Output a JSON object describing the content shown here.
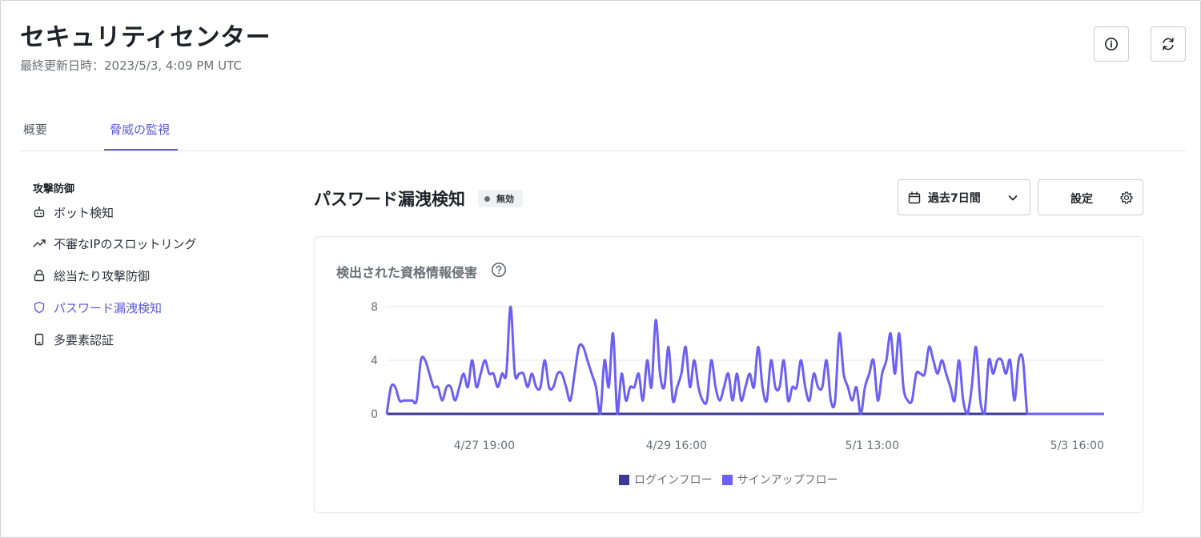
{
  "header": {
    "title": "セキュリティセンター",
    "last_updated": "最終更新日時：2023/5/3, 4:09 PM UTC",
    "info_icon": "info-icon",
    "refresh_icon": "refresh-icon"
  },
  "tabs": [
    {
      "label": "概要",
      "active": false
    },
    {
      "label": "脅威の監視",
      "active": true
    }
  ],
  "sidebar": {
    "heading": "攻撃防御",
    "items": [
      {
        "label": "ボット検知",
        "icon": "robot-icon",
        "active": false
      },
      {
        "label": "不審なIPのスロットリング",
        "icon": "trending-up-icon",
        "active": false
      },
      {
        "label": "総当たり攻撃防御",
        "icon": "lock-icon",
        "active": false
      },
      {
        "label": "パスワード漏洩検知",
        "icon": "shield-icon",
        "active": true
      },
      {
        "label": "多要素認証",
        "icon": "phone-icon",
        "active": false
      }
    ]
  },
  "main": {
    "title": "パスワード漏洩検知",
    "status": "無効",
    "range_select": {
      "value": "過去7日間",
      "icon": "calendar-icon"
    },
    "settings_label": "設定",
    "card_title": "検出された資格情報侵害"
  },
  "colors": {
    "accent": "#5a5bdb",
    "series_login": "#3d3a96",
    "series_signup": "#6b5ff8"
  },
  "chart_data": {
    "type": "line",
    "title": "",
    "xlabel": "",
    "ylabel": "",
    "ylim": [
      0,
      8
    ],
    "y_ticks": [
      0,
      4,
      8
    ],
    "x_ticks": [
      "4/27 19:00",
      "4/29 16:00",
      "5/1 13:00",
      "5/3 16:00"
    ],
    "x_tick_index": [
      30,
      75,
      120,
      168
    ],
    "grid": true,
    "legend_position": "bottom",
    "series": [
      {
        "name": "ログインフロー",
        "color": "#3d3a96",
        "values": [
          0,
          0,
          0,
          0,
          0,
          0,
          0,
          0,
          0,
          0,
          0,
          0,
          0,
          0,
          0,
          0,
          0,
          0,
          0,
          0,
          0,
          0,
          0,
          0,
          0,
          0,
          0,
          0,
          0,
          0,
          0,
          0,
          0,
          0,
          0,
          0,
          0,
          0,
          0,
          0,
          0,
          0,
          0,
          0,
          0,
          0,
          0,
          0,
          0,
          0,
          0,
          0,
          0,
          0,
          0,
          0,
          0,
          0,
          0,
          0,
          0,
          0,
          0,
          0,
          0,
          0,
          0,
          0,
          0,
          0,
          0,
          0,
          0,
          0,
          0,
          0,
          0,
          0,
          0,
          0,
          0,
          0,
          0,
          0,
          0,
          0,
          0,
          0,
          0,
          0,
          0,
          0,
          0,
          0,
          0,
          0,
          0,
          0,
          0,
          0,
          0,
          0,
          0,
          0,
          0,
          0,
          0,
          0,
          0,
          0,
          0,
          0,
          0,
          0,
          0,
          0,
          0,
          0,
          0,
          0,
          0,
          0,
          0,
          0,
          0,
          0,
          0,
          0
        ]
      },
      {
        "name": "サインアップフロー",
        "color": "#6b5ff8",
        "values": [
          0,
          2,
          2,
          1,
          1,
          1,
          1,
          1,
          4,
          4,
          3,
          2,
          2,
          1,
          2,
          2,
          1,
          2,
          3,
          2,
          4,
          2,
          3,
          4,
          3,
          3,
          2,
          3,
          3,
          8,
          3,
          3,
          3,
          2,
          3,
          2,
          2,
          4,
          2,
          2,
          3,
          3,
          2,
          1,
          3,
          5,
          5,
          4,
          3,
          2,
          0,
          4,
          2,
          6,
          0,
          3,
          1,
          2,
          2,
          3,
          1,
          4,
          2,
          7,
          3,
          2,
          5,
          1,
          2,
          3,
          5,
          2,
          4,
          2,
          1,
          1,
          4,
          2,
          1,
          2,
          3,
          1,
          3,
          1,
          2,
          3,
          2,
          5,
          2,
          1,
          4,
          2,
          2,
          4,
          1,
          2,
          2,
          4,
          2,
          1,
          3,
          2,
          2,
          4,
          1,
          1,
          6,
          3,
          2,
          1,
          2,
          0,
          2,
          3,
          4,
          1,
          3,
          4,
          6,
          3,
          6,
          2,
          1,
          1,
          3,
          3,
          3,
          5,
          4,
          3,
          4,
          3,
          2,
          1,
          4,
          1,
          0,
          2,
          5,
          1,
          0,
          4,
          3,
          4,
          4,
          3,
          4,
          1,
          4,
          4,
          0,
          0,
          0,
          0,
          0,
          0,
          0,
          0,
          0,
          0,
          0,
          0,
          0,
          0,
          0,
          0,
          0,
          0,
          0
        ]
      }
    ]
  }
}
